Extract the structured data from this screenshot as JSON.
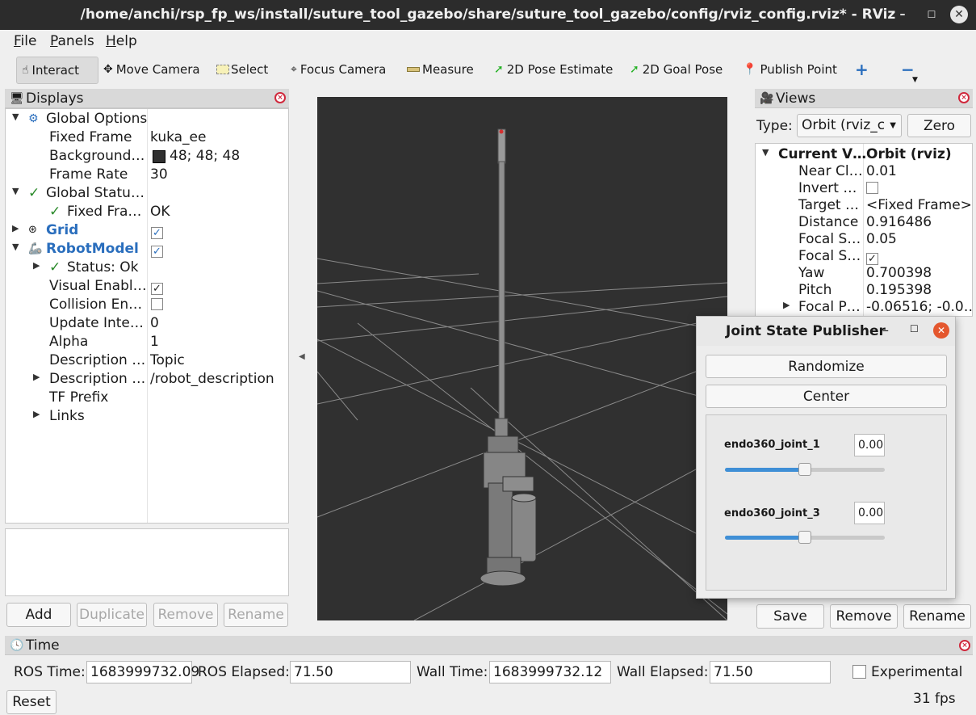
{
  "window": {
    "title": "/home/anchi/rsp_fp_ws/install/suture_tool_gazebo/share/suture_tool_gazebo/config/rviz_config.rviz* - RViz"
  },
  "menu": {
    "file": "File",
    "panels": "Panels",
    "help": "Help"
  },
  "toolbar": {
    "interact": "Interact",
    "move_camera": "Move Camera",
    "select": "Select",
    "focus_camera": "Focus Camera",
    "measure": "Measure",
    "pose_estimate": "2D Pose Estimate",
    "goal_pose": "2D Goal Pose",
    "publish_point": "Publish Point"
  },
  "displays": {
    "title": "Displays",
    "rows": [
      {
        "k": "Global Options",
        "v": ""
      },
      {
        "k": "Fixed Frame",
        "v": "kuka_ee"
      },
      {
        "k": "Background…",
        "v": "48; 48; 48"
      },
      {
        "k": "Frame Rate",
        "v": "30"
      },
      {
        "k": "Global Statu…",
        "v": ""
      },
      {
        "k": "Fixed Fra…",
        "v": "OK"
      },
      {
        "k": "Grid",
        "v": ""
      },
      {
        "k": "RobotModel",
        "v": ""
      },
      {
        "k": "Status: Ok",
        "v": ""
      },
      {
        "k": "Visual Enabl…",
        "v": ""
      },
      {
        "k": "Collision En…",
        "v": ""
      },
      {
        "k": "Update Inte…",
        "v": "0"
      },
      {
        "k": "Alpha",
        "v": "1"
      },
      {
        "k": "Description …",
        "v": "Topic"
      },
      {
        "k": "Description …",
        "v": "/robot_description"
      },
      {
        "k": "TF Prefix",
        "v": ""
      },
      {
        "k": "Links",
        "v": ""
      }
    ],
    "background_color": "#303030",
    "buttons": {
      "add": "Add",
      "duplicate": "Duplicate",
      "remove": "Remove",
      "rename": "Rename"
    }
  },
  "views": {
    "title": "Views",
    "type_label": "Type:",
    "type_value": "Orbit (rviz_c",
    "zero": "Zero",
    "rows": [
      {
        "k": "Current V…",
        "v": "Orbit (rviz)"
      },
      {
        "k": "Near Cl…",
        "v": "0.01"
      },
      {
        "k": "Invert …",
        "v": ""
      },
      {
        "k": "Target …",
        "v": "<Fixed Frame>"
      },
      {
        "k": "Distance",
        "v": "0.916486"
      },
      {
        "k": "Focal S…",
        "v": "0.05"
      },
      {
        "k": "Focal S…",
        "v": ""
      },
      {
        "k": "Yaw",
        "v": "0.700398"
      },
      {
        "k": "Pitch",
        "v": "0.195398"
      },
      {
        "k": "Focal P…",
        "v": "-0.06516; -0.0…"
      }
    ],
    "buttons": {
      "save": "Save",
      "remove": "Remove",
      "rename": "Rename"
    }
  },
  "joint_state_publisher": {
    "title": "Joint State Publisher",
    "randomize": "Randomize",
    "center": "Center",
    "joints": [
      {
        "name": "endo360_joint_1",
        "value": "0.00",
        "slider_fraction": 0.5
      },
      {
        "name": "endo360_joint_3",
        "value": "0.00",
        "slider_fraction": 0.5
      }
    ]
  },
  "time": {
    "title": "Time",
    "ros_time_label": "ROS Time:",
    "ros_time": "1683999732.09",
    "ros_elapsed_label": "ROS Elapsed:",
    "ros_elapsed": "71.50",
    "wall_time_label": "Wall Time:",
    "wall_time": "1683999732.12",
    "wall_elapsed_label": "Wall Elapsed:",
    "wall_elapsed": "71.50",
    "experimental": "Experimental",
    "reset": "Reset",
    "fps": "31 fps"
  }
}
